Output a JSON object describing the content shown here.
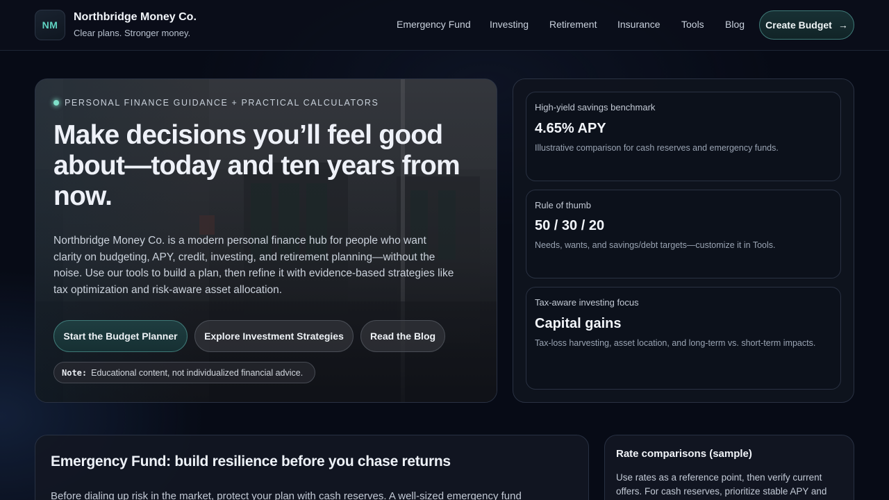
{
  "brand": {
    "logo_initials": "NM",
    "name": "Northbridge Money Co.",
    "tagline": "Clear plans. Stronger money."
  },
  "nav": {
    "items": [
      "Emergency Fund",
      "Investing",
      "Retirement",
      "Insurance",
      "Tools",
      "Blog"
    ],
    "cta_label": "Create Budget",
    "cta_icon": "arrow-right-icon"
  },
  "hero": {
    "eyebrow": "PERSONAL FINANCE GUIDANCE + PRACTICAL CALCULATORS",
    "headline": "Make decisions you’ll feel good about—today and ten years from now.",
    "lede": "Northbridge Money Co. is a modern personal finance hub for people who want clarity on budgeting, APY, credit, investing, and retirement planning—without the noise. Use our tools to build a plan, then refine it with evidence-based strategies like tax optimization and risk-aware asset allocation.",
    "buttons": {
      "primary": "Start the Budget Planner",
      "invest": "Explore Investment Strategies",
      "blog": "Read the Blog"
    },
    "note_code": "Note:",
    "note_text": "Educational content, not individualized financial advice."
  },
  "stats": [
    {
      "label": "High-yield savings benchmark",
      "value": "4.65% APY",
      "desc": "Illustrative comparison for cash reserves and emergency funds."
    },
    {
      "label": "Rule of thumb",
      "value": "50 / 30 / 20",
      "desc": "Needs, wants, and savings/debt targets—customize it in Tools."
    },
    {
      "label": "Tax-aware investing focus",
      "value": "Capital gains",
      "desc": "Tax-loss harvesting, asset location, and long-term vs. short-term impacts."
    }
  ],
  "emergency": {
    "title": "Emergency Fund: build resilience before you chase returns",
    "text": "Before dialing up risk in the market, protect your plan with cash reserves. A well-sized emergency fund"
  },
  "rates": {
    "title": "Rate comparisons (sample)",
    "text": "Use rates as a reference point, then verify current offers. For cash reserves, prioritize stable APY and"
  },
  "colors": {
    "accent": "#5fd3c2",
    "background": "#070b16",
    "cta_border": "#3f7a78"
  }
}
